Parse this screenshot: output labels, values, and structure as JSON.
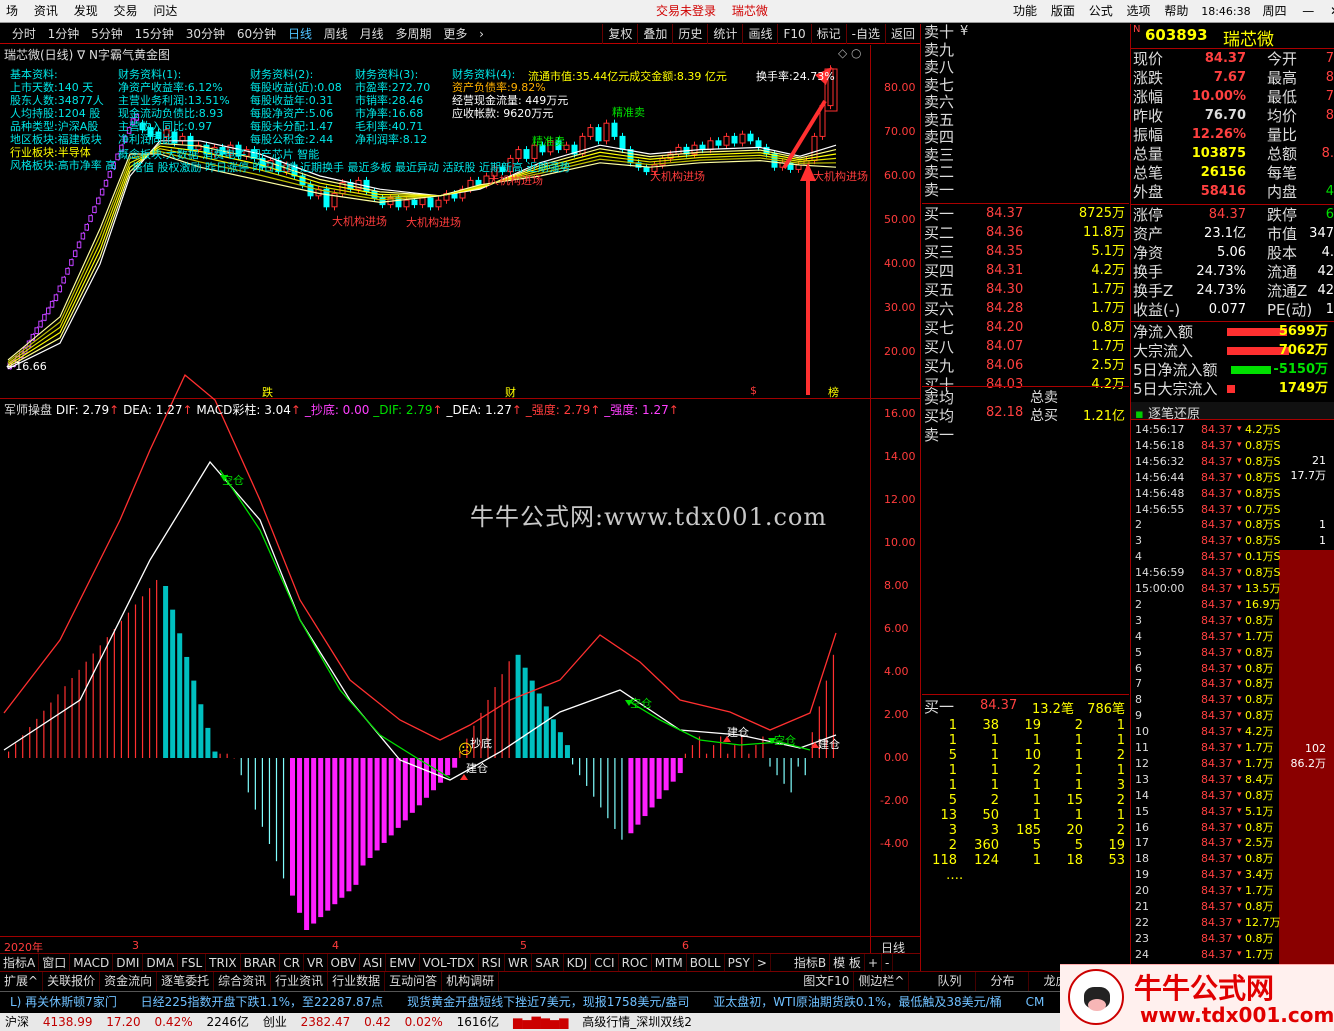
{
  "menu": {
    "items": [
      "场",
      "资讯",
      "发现",
      "交易",
      "问达"
    ],
    "center": [
      "交易未登录",
      "瑞芯微"
    ],
    "right": [
      "功能",
      "版面",
      "公式",
      "选项",
      "帮助"
    ],
    "time": "18:46:38",
    "weekday": "周四"
  },
  "periods": [
    "分时",
    "1分钟",
    "5分钟",
    "15分钟",
    "30分钟",
    "60分钟",
    "日线",
    "周线",
    "月线",
    "多周期",
    "更多"
  ],
  "tools": [
    "复权",
    "叠加",
    "历史",
    "统计",
    "画线",
    "F10",
    "标记",
    "-自选",
    "返回"
  ],
  "chart_title": "瑞芯微(日线) ∇ N字霸气黄金图",
  "info_block": {
    "col1": [
      "基本资料:",
      "上市天数:140 天",
      "股东人数:34877人",
      "人均持股:1204 股",
      "品种类型:沪深A股",
      "地区板块:福建板块",
      "行业板块:半导体",
      "风格板块:高市净率 高"
    ],
    "col2": [
      "财务资料(1):",
      "净资产收益率:6.12%",
      "主营业务利润:13.51%",
      "现金流动负债比:8.93",
      "主营收入同比:0.97",
      "净利润同比:"
    ],
    "col3": [
      "财务资料(2):",
      "每股收益(近):0.08",
      "每股收益年:0.31",
      "每股净资产:5.06",
      "每股未分配:1.47",
      "每股公积金:2.44"
    ],
    "col4": [
      "财务资料(3):",
      "市盈率:272.70",
      "市销率:28.46",
      "市净率:16.68",
      "毛利率:40.71",
      "净利润率:8.12"
    ],
    "col5": [
      "财务资料(4):",
      "资产负债率:9.82%",
      "经营现金流量: 449万元",
      "应收帐款: 9620万元"
    ],
    "market_val": "流通市值:35.44亿元成交金额:8.39 亿元",
    "turnover": "换手率:24.73%",
    "concept_line": "概念板块:大数据 消费电子 国产芯片 智能",
    "style_line2": "塔值 股权激励 昨日涨停 昨日上榜 近期换手 最近多板 最近异动 活跃股 近期新高 近期强势"
  },
  "signals": [
    "精准卖",
    "精准卖",
    "大机构进场",
    "大机构进场",
    "大机构进场",
    "大机构进场",
    "大机构进场"
  ],
  "price_axis": [
    "80.00",
    "70.00",
    "60.00",
    "50.00",
    "40.00",
    "30.00",
    "20.00"
  ],
  "low_label": "16.66",
  "markers": [
    "跌",
    "财",
    "$",
    "榜"
  ],
  "indicator": {
    "name": "军师操盘",
    "dif": "DIF: 2.79",
    "dea": "DEA: 1.27",
    "macd": "MACD彩柱: 3.04",
    "chaodi": "_抄底: 0.00",
    "dif2": "_DIF: 2.79",
    "dea2": "_DEA: 1.27",
    "qiang1": "_强度: 2.79",
    "qiang2": "_强度: 1.27",
    "axis": [
      "16.00",
      "14.00",
      "12.00",
      "10.00",
      "8.00",
      "6.00",
      "4.00",
      "2.00",
      "0.00",
      "-2.00",
      "-4.00"
    ],
    "labels": [
      "空仓",
      "抄底",
      "建仓",
      "空仓",
      "建仓",
      "空仓",
      "建仓"
    ]
  },
  "watermark": "牛牛公式网:www.tdx001.com",
  "date_axis": [
    "2020年",
    "3",
    "4",
    "5",
    "6"
  ],
  "date_right": "日线",
  "chart_data": [
    {
      "type": "candlestick",
      "title": "瑞芯微(日线)",
      "y_range": [
        16,
        86
      ],
      "last_close": 84.37
    },
    {
      "type": "bar",
      "title": "军师操盘",
      "y_range": [
        -7,
        17
      ],
      "dif": 2.79,
      "dea": 1.27,
      "macd": 3.04
    }
  ],
  "order_book": {
    "sell_labels": [
      "卖十",
      "卖九",
      "卖八",
      "卖七",
      "卖六",
      "卖五",
      "卖四",
      "卖三",
      "卖二",
      "卖一"
    ],
    "sell_extra": "¥",
    "buy": [
      [
        "买一",
        "84.37",
        "8725万"
      ],
      [
        "买二",
        "84.36",
        "11.8万"
      ],
      [
        "买三",
        "84.35",
        "5.1万"
      ],
      [
        "买四",
        "84.31",
        "4.2万"
      ],
      [
        "买五",
        "84.30",
        "1.7万"
      ],
      [
        "买六",
        "84.28",
        "1.7万"
      ],
      [
        "买七",
        "84.20",
        "0.8万"
      ],
      [
        "买八",
        "84.07",
        "1.7万"
      ],
      [
        "买九",
        "84.06",
        "2.5万"
      ],
      [
        "买十",
        "84.03",
        "4.2万"
      ]
    ],
    "maijun_label": "卖均",
    "maijun_label2": "买均",
    "maijun_val": "82.18",
    "zongmai": "总卖",
    "zongmai2": "总买",
    "zongmai_val": "1.21亿",
    "sell1": "卖一",
    "buy1_row": [
      "买一",
      "84.37",
      "13.2笔",
      "786笔"
    ],
    "queue": [
      [
        "1",
        "38",
        "19",
        "2",
        "1"
      ],
      [
        "1",
        "1",
        "1",
        "1",
        "1"
      ],
      [
        "5",
        "1",
        "10",
        "1",
        "2"
      ],
      [
        "1",
        "1",
        "2",
        "1",
        "1"
      ],
      [
        "1",
        "1",
        "1",
        "1",
        "3"
      ],
      [
        "5",
        "2",
        "1",
        "15",
        "2"
      ],
      [
        "13",
        "50",
        "1",
        "1",
        "1"
      ],
      [
        "3",
        "3",
        "185",
        "20",
        "2"
      ],
      [
        "2",
        "360",
        "5",
        "5",
        "19"
      ],
      [
        "118",
        "124",
        "1",
        "18",
        "53"
      ]
    ],
    "more": "…."
  },
  "quote": {
    "code": "603893",
    "name": "瑞芯微",
    "prefix": "N",
    "rows": [
      [
        "现价",
        "84.37",
        "今开",
        "7"
      ],
      [
        "涨跌",
        "7.67",
        "最高",
        "8"
      ],
      [
        "涨幅",
        "10.00%",
        "最低",
        "7"
      ],
      [
        "昨收",
        "76.70",
        "均价",
        "8"
      ],
      [
        "振幅",
        "12.26%",
        "量比",
        ""
      ],
      [
        "总量",
        "103875",
        "总额",
        "8."
      ],
      [
        "总笔",
        "26156",
        "每笔",
        ""
      ],
      [
        "外盘",
        "58416",
        "内盘",
        "4"
      ]
    ],
    "rows2": [
      [
        "涨停",
        "84.37",
        "跌停",
        "6"
      ],
      [
        "资产",
        "23.1亿",
        "市值",
        "347"
      ],
      [
        "净资",
        "5.06",
        "股本",
        "4."
      ],
      [
        "换手",
        "24.73%",
        "流通",
        "42"
      ],
      [
        "换手Z",
        "24.73%",
        "流通Z",
        "42"
      ],
      [
        "收益(-)",
        "0.077",
        "PE(动)",
        "1"
      ]
    ],
    "flows": [
      [
        "净流入额",
        "5699万"
      ],
      [
        "大宗流入",
        "7062万"
      ],
      [
        "5日净流入额",
        "-5150万"
      ],
      [
        "5日大宗流入",
        "1749万"
      ]
    ]
  },
  "ticks": {
    "title": "逐笔还原",
    "rows": [
      [
        "14:56:17",
        "84.37",
        "4.2万S"
      ],
      [
        "14:56:18",
        "84.37",
        "0.8万S"
      ],
      [
        "14:56:32",
        "84.37",
        "0.8万S"
      ],
      [
        "14:56:44",
        "84.37",
        "0.8万S"
      ],
      [
        "14:56:48",
        "84.37",
        "0.8万S"
      ],
      [
        "14:56:55",
        "84.37",
        "0.7万S"
      ],
      [
        "2",
        "84.37",
        "0.8万S"
      ],
      [
        "3",
        "84.37",
        "0.8万S"
      ],
      [
        "4",
        "84.37",
        "0.1万S"
      ],
      [
        "14:56:59",
        "84.37",
        "0.8万S"
      ],
      [
        "15:00:00",
        "84.37",
        "13.5万"
      ],
      [
        "2",
        "84.37",
        "16.9万"
      ],
      [
        "3",
        "84.37",
        "0.8万"
      ],
      [
        "4",
        "84.37",
        "1.7万"
      ],
      [
        "5",
        "84.37",
        "0.8万"
      ],
      [
        "6",
        "84.37",
        "0.8万"
      ],
      [
        "7",
        "84.37",
        "0.8万"
      ],
      [
        "8",
        "84.37",
        "0.8万"
      ],
      [
        "9",
        "84.37",
        "0.8万"
      ],
      [
        "10",
        "84.37",
        "4.2万"
      ],
      [
        "11",
        "84.37",
        "1.7万"
      ],
      [
        "12",
        "84.37",
        "1.7万"
      ],
      [
        "13",
        "84.37",
        "8.4万"
      ],
      [
        "14",
        "84.37",
        "0.8万"
      ],
      [
        "15",
        "84.37",
        "5.1万"
      ],
      [
        "16",
        "84.37",
        "0.8万"
      ],
      [
        "17",
        "84.37",
        "2.5万"
      ],
      [
        "18",
        "84.37",
        "0.8万"
      ],
      [
        "19",
        "84.37",
        "3.4万"
      ],
      [
        "20",
        "84.37",
        "1.7万"
      ],
      [
        "21",
        "84.37",
        "0.8万"
      ],
      [
        "22",
        "84.37",
        "12.7万"
      ],
      [
        "23",
        "84.37",
        "0.8万"
      ],
      [
        "24",
        "84.37",
        "1.7万"
      ]
    ],
    "side": [
      [
        "21",
        "17.7万"
      ],
      [
        "1",
        ""
      ],
      [
        "1",
        ""
      ],
      [
        "102",
        "86.2万"
      ]
    ]
  },
  "bottom_tabs": [
    "指标A",
    "窗口",
    "MACD",
    "DMI",
    "DMA",
    "FSL",
    "TRIX",
    "BRAR",
    "CR",
    "VR",
    "OBV",
    "ASI",
    "EMV",
    "VOL-TDX",
    "RSI",
    "WR",
    "SAR",
    "KDJ",
    "CCI",
    "ROC",
    "MTM",
    "BOLL",
    "PSY",
    ">",
    "指标B",
    "模 板",
    "+",
    "-"
  ],
  "bottom_tabs2": [
    "扩展^",
    "关联报价",
    "资金流向",
    "逐笔委托",
    "综合资讯",
    "行业资讯",
    "行业数据",
    "互动问答",
    "机构调研",
    "图文F10",
    "侧边栏^",
    "队列",
    "分布",
    "龙虎"
  ],
  "news": [
    "L) 再关休斯顿7家门",
    "日经225指数开盘下跌1.1%，至22287.87点",
    "现货黄金开盘短线下挫近7美元，现报1758美元/盎司",
    "亚太盘初，WTI原油期货跌0.1%，最低触及38美元/桶",
    "CM"
  ],
  "status": {
    "sh_label": "沪深",
    "sh": "4138.99",
    "sh_chg": "17.20",
    "sh_pct": "0.42%",
    "sh_amt": "2246亿",
    "cy_label": "创业",
    "cy": "2382.47",
    "cy_chg": "0.42",
    "cy_pct": "0.02%",
    "cy_amt": "1616亿",
    "right": "高级行情_深圳双线2"
  },
  "logo": {
    "text": "牛牛公式网",
    "url": "www.tdx001.com"
  }
}
